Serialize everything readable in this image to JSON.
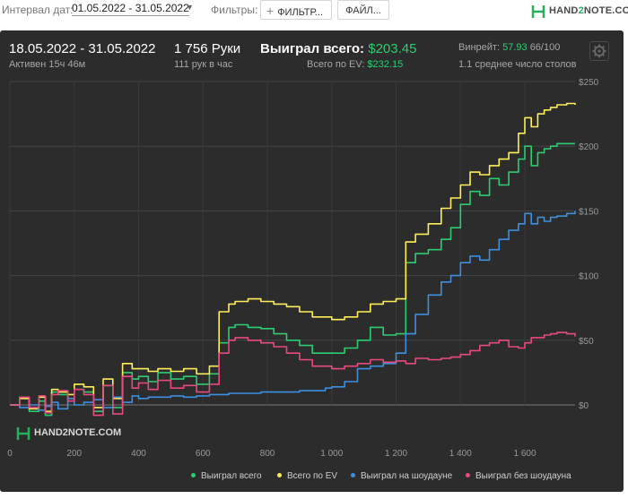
{
  "toolbar": {
    "interval_label": "Интервал дат:",
    "interval_value": "01.05.2022 - 31.05.2022",
    "filters_label": "Фильтры:",
    "filter_button": "ФИЛЬТР...",
    "file_button": "ФАЙЛ...",
    "logo_pre": "HAND",
    "logo_two": "2",
    "logo_post": "NOTE.COM"
  },
  "stats": {
    "period": "18.05.2022 - 31.05.2022",
    "active": "Активен 15ч 46м",
    "hands": "1 756 Руки",
    "hands_per_hour": "111 рук в час",
    "won_label": "Выиграл всего:",
    "won_value": "$203.45",
    "ev_label": "Всего по EV:",
    "ev_value": "$232.15",
    "winrate_label": "Винрейт:",
    "winrate_value": "57.93",
    "winrate_extra": "66/100",
    "tables": "1.1 среднее число столов"
  },
  "chart_data": {
    "type": "line",
    "x_ticks": [
      "0",
      "200",
      "400",
      "600",
      "800",
      "1 000",
      "1 200",
      "1 400",
      "1 600"
    ],
    "y_ticks": [
      "$250",
      "$200",
      "$150",
      "$100",
      "$50",
      "$0"
    ],
    "xlim": [
      0,
      1756
    ],
    "ylim": [
      0,
      250
    ],
    "grid": true,
    "legend_position": "bottom-right",
    "watermark": "HAND2NOTE.COM",
    "series": [
      {
        "name": "Выиграл всего",
        "color": "#2ecc71",
        "x": [
          0,
          30,
          60,
          90,
          110,
          130,
          150,
          180,
          200,
          230,
          260,
          290,
          320,
          350,
          380,
          400,
          430,
          460,
          500,
          540,
          580,
          620,
          650,
          680,
          700,
          740,
          780,
          820,
          860,
          900,
          940,
          980,
          1000,
          1040,
          1080,
          1120,
          1160,
          1200,
          1230,
          1260,
          1300,
          1340,
          1370,
          1400,
          1430,
          1460,
          1490,
          1520,
          1550,
          1580,
          1600,
          1620,
          1640,
          1660,
          1680,
          1700,
          1730,
          1756
        ],
        "y": [
          0,
          5,
          -5,
          3,
          -8,
          10,
          8,
          5,
          12,
          10,
          -5,
          15,
          -2,
          25,
          20,
          22,
          18,
          25,
          20,
          22,
          16,
          24,
          48,
          60,
          62,
          60,
          59,
          55,
          50,
          46,
          40,
          40,
          40,
          44,
          50,
          60,
          54,
          55,
          110,
          117,
          120,
          128,
          137,
          155,
          165,
          162,
          175,
          170,
          180,
          190,
          200,
          185,
          195,
          198,
          200,
          202,
          202,
          202
        ]
      },
      {
        "name": "Всего по EV",
        "color": "#ffee58",
        "x": [
          0,
          30,
          60,
          90,
          110,
          130,
          150,
          180,
          200,
          230,
          260,
          290,
          320,
          350,
          380,
          400,
          430,
          460,
          500,
          540,
          580,
          620,
          650,
          680,
          700,
          740,
          780,
          820,
          860,
          900,
          940,
          980,
          1000,
          1040,
          1080,
          1120,
          1160,
          1200,
          1230,
          1260,
          1300,
          1340,
          1370,
          1400,
          1430,
          1460,
          1490,
          1520,
          1550,
          1580,
          1600,
          1620,
          1640,
          1660,
          1680,
          1700,
          1730,
          1756
        ],
        "y": [
          0,
          5,
          -3,
          6,
          -5,
          12,
          10,
          8,
          16,
          14,
          -2,
          20,
          5,
          32,
          28,
          28,
          26,
          28,
          26,
          28,
          24,
          30,
          72,
          78,
          80,
          82,
          80,
          78,
          76,
          72,
          68,
          68,
          66,
          68,
          72,
          78,
          80,
          82,
          126,
          132,
          140,
          152,
          160,
          170,
          180,
          178,
          185,
          190,
          195,
          210,
          222,
          215,
          225,
          228,
          230,
          232,
          233,
          232
        ]
      },
      {
        "name": "Выиграл на шоудауне",
        "color": "#3d8fe0",
        "x": [
          0,
          30,
          60,
          90,
          110,
          130,
          150,
          180,
          200,
          230,
          260,
          290,
          320,
          350,
          380,
          400,
          430,
          460,
          500,
          540,
          580,
          620,
          650,
          680,
          700,
          740,
          780,
          820,
          860,
          900,
          940,
          980,
          1000,
          1040,
          1080,
          1120,
          1160,
          1200,
          1230,
          1260,
          1300,
          1340,
          1370,
          1400,
          1430,
          1460,
          1490,
          1520,
          1550,
          1580,
          1600,
          1620,
          1640,
          1660,
          1680,
          1700,
          1730,
          1756
        ],
        "y": [
          0,
          -2,
          0,
          -4,
          -1,
          2,
          -3,
          5,
          0,
          2,
          4,
          -2,
          6,
          2,
          7,
          5,
          6,
          6,
          7,
          6,
          7,
          8,
          8,
          9,
          9,
          9,
          10,
          10,
          10,
          11,
          11,
          13,
          14,
          18,
          28,
          30,
          32,
          40,
          55,
          70,
          85,
          95,
          100,
          110,
          115,
          112,
          120,
          128,
          135,
          140,
          148,
          140,
          145,
          142,
          145,
          146,
          148,
          150
        ]
      },
      {
        "name": "Выиграл без шоудауна",
        "color": "#e84a7f",
        "x": [
          0,
          30,
          60,
          90,
          110,
          130,
          150,
          180,
          200,
          230,
          260,
          290,
          320,
          350,
          380,
          400,
          430,
          460,
          500,
          540,
          580,
          620,
          650,
          680,
          700,
          740,
          780,
          820,
          860,
          900,
          940,
          980,
          1000,
          1040,
          1080,
          1120,
          1160,
          1200,
          1230,
          1260,
          1300,
          1340,
          1370,
          1400,
          1430,
          1460,
          1490,
          1520,
          1550,
          1580,
          1600,
          1620,
          1640,
          1660,
          1680,
          1700,
          1730,
          1756
        ],
        "y": [
          0,
          6,
          -2,
          7,
          -6,
          8,
          11,
          3,
          12,
          8,
          -8,
          15,
          -7,
          22,
          13,
          17,
          12,
          19,
          13,
          15,
          10,
          16,
          40,
          50,
          52,
          50,
          48,
          45,
          40,
          35,
          30,
          30,
          28,
          30,
          32,
          35,
          33,
          34,
          32,
          36,
          35,
          36,
          37,
          39,
          42,
          46,
          48,
          50,
          45,
          44,
          48,
          52,
          52,
          54,
          55,
          56,
          55,
          53
        ]
      }
    ]
  }
}
